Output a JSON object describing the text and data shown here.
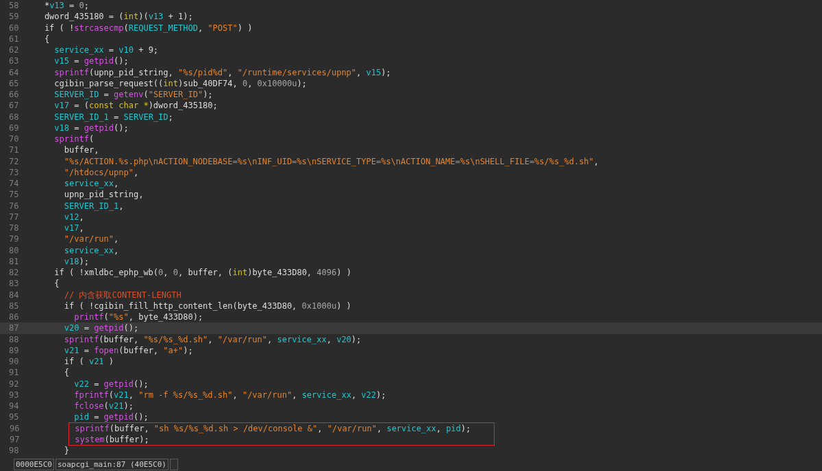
{
  "lines": [
    {
      "number": "58",
      "current": false,
      "boxed": false,
      "tokens": [
        {
          "kind": "plain",
          "text": "*"
        },
        {
          "kind": "var",
          "text": "v13"
        },
        {
          "kind": "plain",
          "text": " = "
        },
        {
          "kind": "num",
          "text": "0"
        },
        {
          "kind": "plain",
          "text": ";"
        }
      ]
    },
    {
      "number": "59",
      "current": false,
      "boxed": false,
      "tokens": [
        {
          "kind": "plain",
          "text": "dword_435180 = ("
        },
        {
          "kind": "keyword",
          "text": "int"
        },
        {
          "kind": "plain",
          "text": ")("
        },
        {
          "kind": "var",
          "text": "v13"
        },
        {
          "kind": "plain",
          "text": " + 1);"
        }
      ]
    },
    {
      "number": "60",
      "current": false,
      "boxed": false,
      "tokens": [
        {
          "kind": "plain",
          "text": "if ( !"
        },
        {
          "kind": "func",
          "text": "strcasecmp"
        },
        {
          "kind": "plain",
          "text": "("
        },
        {
          "kind": "var",
          "text": "REQUEST_METHOD"
        },
        {
          "kind": "plain",
          "text": ", "
        },
        {
          "kind": "string",
          "text": "\"POST\""
        },
        {
          "kind": "plain",
          "text": ") )"
        }
      ]
    },
    {
      "number": "61",
      "current": false,
      "boxed": false,
      "tokens": [
        {
          "kind": "plain",
          "text": "{"
        }
      ],
      "children": [
        {
          "number": "62",
          "current": false,
          "boxed": false,
          "tokens": [
            {
              "kind": "var",
              "text": "service_xx"
            },
            {
              "kind": "plain",
              "text": " = "
            },
            {
              "kind": "var",
              "text": "v10"
            },
            {
              "kind": "plain",
              "text": " + 9;"
            }
          ]
        },
        {
          "number": "63",
          "current": false,
          "boxed": false,
          "tokens": [
            {
              "kind": "var",
              "text": "v15"
            },
            {
              "kind": "plain",
              "text": " = "
            },
            {
              "kind": "func",
              "text": "getpid"
            },
            {
              "kind": "plain",
              "text": "();"
            }
          ]
        },
        {
          "number": "64",
          "current": false,
          "boxed": false,
          "tokens": [
            {
              "kind": "func",
              "text": "sprintf"
            },
            {
              "kind": "plain",
              "text": "(upnp_pid_string, "
            },
            {
              "kind": "string",
              "text": "\"%s/pid%d\""
            },
            {
              "kind": "plain",
              "text": ", "
            },
            {
              "kind": "string",
              "text": "\"/runtime/services/upnp\""
            },
            {
              "kind": "plain",
              "text": ", "
            },
            {
              "kind": "var",
              "text": "v15"
            },
            {
              "kind": "plain",
              "text": ");"
            }
          ]
        },
        {
          "number": "65",
          "current": false,
          "boxed": false,
          "tokens": [
            {
              "kind": "plain",
              "text": "cgibin_parse_request(("
            },
            {
              "kind": "keyword",
              "text": "int"
            },
            {
              "kind": "plain",
              "text": ")sub_40DF74, "
            },
            {
              "kind": "num",
              "text": "0"
            },
            {
              "kind": "plain",
              "text": ", "
            },
            {
              "kind": "num",
              "text": "0x10000u"
            },
            {
              "kind": "plain",
              "text": ");"
            }
          ]
        },
        {
          "number": "66",
          "current": false,
          "boxed": false,
          "tokens": [
            {
              "kind": "var",
              "text": "SERVER_ID"
            },
            {
              "kind": "plain",
              "text": " = "
            },
            {
              "kind": "func",
              "text": "getenv"
            },
            {
              "kind": "plain",
              "text": "("
            },
            {
              "kind": "string",
              "text": "\"SERVER_ID\""
            },
            {
              "kind": "plain",
              "text": ");"
            }
          ]
        },
        {
          "number": "67",
          "current": false,
          "boxed": false,
          "tokens": [
            {
              "kind": "var",
              "text": "v17"
            },
            {
              "kind": "plain",
              "text": " = ("
            },
            {
              "kind": "keyword",
              "text": "const char *"
            },
            {
              "kind": "plain",
              "text": ")dword_435180;"
            }
          ]
        },
        {
          "number": "68",
          "current": false,
          "boxed": false,
          "tokens": [
            {
              "kind": "var",
              "text": "SERVER_ID_1"
            },
            {
              "kind": "plain",
              "text": " = "
            },
            {
              "kind": "var",
              "text": "SERVER_ID"
            },
            {
              "kind": "plain",
              "text": ";"
            }
          ]
        },
        {
          "number": "69",
          "current": false,
          "boxed": false,
          "tokens": [
            {
              "kind": "var",
              "text": "v18"
            },
            {
              "kind": "plain",
              "text": " = "
            },
            {
              "kind": "func",
              "text": "getpid"
            },
            {
              "kind": "plain",
              "text": "();"
            }
          ]
        },
        {
          "number": "70",
          "current": false,
          "boxed": false,
          "tokens": [
            {
              "kind": "func",
              "text": "sprintf"
            },
            {
              "kind": "plain",
              "text": "("
            }
          ],
          "children": [
            {
              "number": "71",
              "current": false,
              "boxed": false,
              "tokens": [
                {
                  "kind": "plain",
                  "text": "buffer,"
                }
              ]
            },
            {
              "number": "72",
              "current": false,
              "boxed": false,
              "tokens": [
                {
                  "kind": "string",
                  "text": "\"%s/ACTION.%s.php\\nACTION_NODEBASE=%s\\nINF_UID=%s\\nSERVICE_TYPE=%s\\nACTION_NAME=%s\\nSHELL_FILE=%s/%s_%d.sh\""
                },
                {
                  "kind": "plain",
                  "text": ","
                }
              ]
            },
            {
              "number": "73",
              "current": false,
              "boxed": false,
              "tokens": [
                {
                  "kind": "string",
                  "text": "\"/htdocs/upnp\""
                },
                {
                  "kind": "plain",
                  "text": ","
                }
              ]
            },
            {
              "number": "74",
              "current": false,
              "boxed": false,
              "tokens": [
                {
                  "kind": "var",
                  "text": "service_xx"
                },
                {
                  "kind": "plain",
                  "text": ","
                }
              ]
            },
            {
              "number": "75",
              "current": false,
              "boxed": false,
              "tokens": [
                {
                  "kind": "plain",
                  "text": "upnp_pid_string,"
                }
              ]
            },
            {
              "number": "76",
              "current": false,
              "boxed": false,
              "tokens": [
                {
                  "kind": "var",
                  "text": "SERVER_ID_1"
                },
                {
                  "kind": "plain",
                  "text": ","
                }
              ]
            },
            {
              "number": "77",
              "current": false,
              "boxed": false,
              "tokens": [
                {
                  "kind": "var",
                  "text": "v12"
                },
                {
                  "kind": "plain",
                  "text": ","
                }
              ]
            },
            {
              "number": "78",
              "current": false,
              "boxed": false,
              "tokens": [
                {
                  "kind": "var",
                  "text": "v17"
                },
                {
                  "kind": "plain",
                  "text": ","
                }
              ]
            },
            {
              "number": "79",
              "current": false,
              "boxed": false,
              "tokens": [
                {
                  "kind": "string",
                  "text": "\"/var/run\""
                },
                {
                  "kind": "plain",
                  "text": ","
                }
              ]
            },
            {
              "number": "80",
              "current": false,
              "boxed": false,
              "tokens": [
                {
                  "kind": "var",
                  "text": "service_xx"
                },
                {
                  "kind": "plain",
                  "text": ","
                }
              ]
            },
            {
              "number": "81",
              "current": false,
              "boxed": false,
              "tokens": [
                {
                  "kind": "var",
                  "text": "v18"
                },
                {
                  "kind": "plain",
                  "text": ");"
                }
              ]
            }
          ]
        },
        {
          "number": "82",
          "current": false,
          "boxed": false,
          "tokens": [
            {
              "kind": "plain",
              "text": "if ( !xmldbc_ephp_wb("
            },
            {
              "kind": "num",
              "text": "0"
            },
            {
              "kind": "plain",
              "text": ", "
            },
            {
              "kind": "num",
              "text": "0"
            },
            {
              "kind": "plain",
              "text": ", buffer, ("
            },
            {
              "kind": "keyword",
              "text": "int"
            },
            {
              "kind": "plain",
              "text": ")byte_433D80, "
            },
            {
              "kind": "num",
              "text": "4096"
            },
            {
              "kind": "plain",
              "text": ") )"
            }
          ]
        },
        {
          "number": "83",
          "current": false,
          "boxed": false,
          "tokens": [
            {
              "kind": "plain",
              "text": "{"
            }
          ],
          "children": [
            {
              "number": "84",
              "current": false,
              "boxed": false,
              "tokens": [
                {
                  "kind": "comment",
                  "text": "// 内含获取CONTENT-LENGTH"
                }
              ]
            },
            {
              "number": "85",
              "current": false,
              "boxed": false,
              "tokens": [
                {
                  "kind": "plain",
                  "text": "if ( !cgibin_fill_http_content_len(byte_433D80, "
                },
                {
                  "kind": "num",
                  "text": "0x1000u"
                },
                {
                  "kind": "plain",
                  "text": ") )"
                }
              ],
              "children": [
                {
                  "number": "86",
                  "current": false,
                  "boxed": false,
                  "tokens": [
                    {
                      "kind": "func",
                      "text": "printf"
                    },
                    {
                      "kind": "plain",
                      "text": "("
                    },
                    {
                      "kind": "string",
                      "text": "\"%s\""
                    },
                    {
                      "kind": "plain",
                      "text": ", byte_433D80);"
                    }
                  ]
                }
              ]
            },
            {
              "number": "87",
              "current": true,
              "boxed": false,
              "tokens": [
                {
                  "kind": "var",
                  "text": "v20"
                },
                {
                  "kind": "plain",
                  "text": " = "
                },
                {
                  "kind": "func",
                  "text": "getpid"
                },
                {
                  "kind": "plain",
                  "text": "();"
                }
              ]
            },
            {
              "number": "88",
              "current": false,
              "boxed": false,
              "tokens": [
                {
                  "kind": "func",
                  "text": "sprintf"
                },
                {
                  "kind": "plain",
                  "text": "(buffer, "
                },
                {
                  "kind": "string",
                  "text": "\"%s/%s_%d.sh\""
                },
                {
                  "kind": "plain",
                  "text": ", "
                },
                {
                  "kind": "string",
                  "text": "\"/var/run\""
                },
                {
                  "kind": "plain",
                  "text": ", "
                },
                {
                  "kind": "var",
                  "text": "service_xx"
                },
                {
                  "kind": "plain",
                  "text": ", "
                },
                {
                  "kind": "var",
                  "text": "v20"
                },
                {
                  "kind": "plain",
                  "text": ");"
                }
              ]
            },
            {
              "number": "89",
              "current": false,
              "boxed": false,
              "tokens": [
                {
                  "kind": "var",
                  "text": "v21"
                },
                {
                  "kind": "plain",
                  "text": " = "
                },
                {
                  "kind": "func",
                  "text": "fopen"
                },
                {
                  "kind": "plain",
                  "text": "(buffer, "
                },
                {
                  "kind": "string",
                  "text": "\"a+\""
                },
                {
                  "kind": "plain",
                  "text": ");"
                }
              ]
            },
            {
              "number": "90",
              "current": false,
              "boxed": false,
              "tokens": [
                {
                  "kind": "plain",
                  "text": "if ( "
                },
                {
                  "kind": "var",
                  "text": "v21"
                },
                {
                  "kind": "plain",
                  "text": " )"
                }
              ]
            },
            {
              "number": "91",
              "current": false,
              "boxed": false,
              "tokens": [
                {
                  "kind": "plain",
                  "text": "{"
                }
              ],
              "children": [
                {
                  "number": "92",
                  "current": false,
                  "boxed": false,
                  "tokens": [
                    {
                      "kind": "var",
                      "text": "v22"
                    },
                    {
                      "kind": "plain",
                      "text": " = "
                    },
                    {
                      "kind": "func",
                      "text": "getpid"
                    },
                    {
                      "kind": "plain",
                      "text": "();"
                    }
                  ]
                },
                {
                  "number": "93",
                  "current": false,
                  "boxed": false,
                  "tokens": [
                    {
                      "kind": "func",
                      "text": "fprintf"
                    },
                    {
                      "kind": "plain",
                      "text": "("
                    },
                    {
                      "kind": "var",
                      "text": "v21"
                    },
                    {
                      "kind": "plain",
                      "text": ", "
                    },
                    {
                      "kind": "string",
                      "text": "\"rm -f %s/%s_%d.sh\""
                    },
                    {
                      "kind": "plain",
                      "text": ", "
                    },
                    {
                      "kind": "string",
                      "text": "\"/var/run\""
                    },
                    {
                      "kind": "plain",
                      "text": ", "
                    },
                    {
                      "kind": "var",
                      "text": "service_xx"
                    },
                    {
                      "kind": "plain",
                      "text": ", "
                    },
                    {
                      "kind": "var",
                      "text": "v22"
                    },
                    {
                      "kind": "plain",
                      "text": ");"
                    }
                  ]
                },
                {
                  "number": "94",
                  "current": false,
                  "boxed": false,
                  "tokens": [
                    {
                      "kind": "func",
                      "text": "fclose"
                    },
                    {
                      "kind": "plain",
                      "text": "("
                    },
                    {
                      "kind": "var",
                      "text": "v21"
                    },
                    {
                      "kind": "plain",
                      "text": ");"
                    }
                  ]
                },
                {
                  "number": "95",
                  "current": false,
                  "boxed": false,
                  "tokens": [
                    {
                      "kind": "var",
                      "text": "pid"
                    },
                    {
                      "kind": "plain",
                      "text": " = "
                    },
                    {
                      "kind": "func",
                      "text": "getpid"
                    },
                    {
                      "kind": "plain",
                      "text": "();"
                    }
                  ]
                },
                {
                  "number": "96",
                  "current": false,
                  "boxed": true,
                  "tokens": [
                    {
                      "kind": "func",
                      "text": "sprintf"
                    },
                    {
                      "kind": "plain",
                      "text": "(buffer, "
                    },
                    {
                      "kind": "string",
                      "text": "\"sh %s/%s_%d.sh > /dev/console &\""
                    },
                    {
                      "kind": "plain",
                      "text": ", "
                    },
                    {
                      "kind": "string",
                      "text": "\"/var/run\""
                    },
                    {
                      "kind": "plain",
                      "text": ", "
                    },
                    {
                      "kind": "var",
                      "text": "service_xx"
                    },
                    {
                      "kind": "plain",
                      "text": ", "
                    },
                    {
                      "kind": "var",
                      "text": "pid"
                    },
                    {
                      "kind": "plain",
                      "text": ");"
                    }
                  ]
                },
                {
                  "number": "97",
                  "current": false,
                  "boxed": true,
                  "tokens": [
                    {
                      "kind": "func",
                      "text": "system"
                    },
                    {
                      "kind": "plain",
                      "text": "(buffer);"
                    }
                  ]
                }
              ]
            },
            {
              "number": "98",
              "current": false,
              "boxed": false,
              "tokens": [
                {
                  "kind": "plain",
                  "text": "}"
                }
              ]
            }
          ]
        }
      ]
    }
  ],
  "status_bar": [
    "0000E5C0",
    "soapcgi_main:87 (40E5C0)"
  ]
}
